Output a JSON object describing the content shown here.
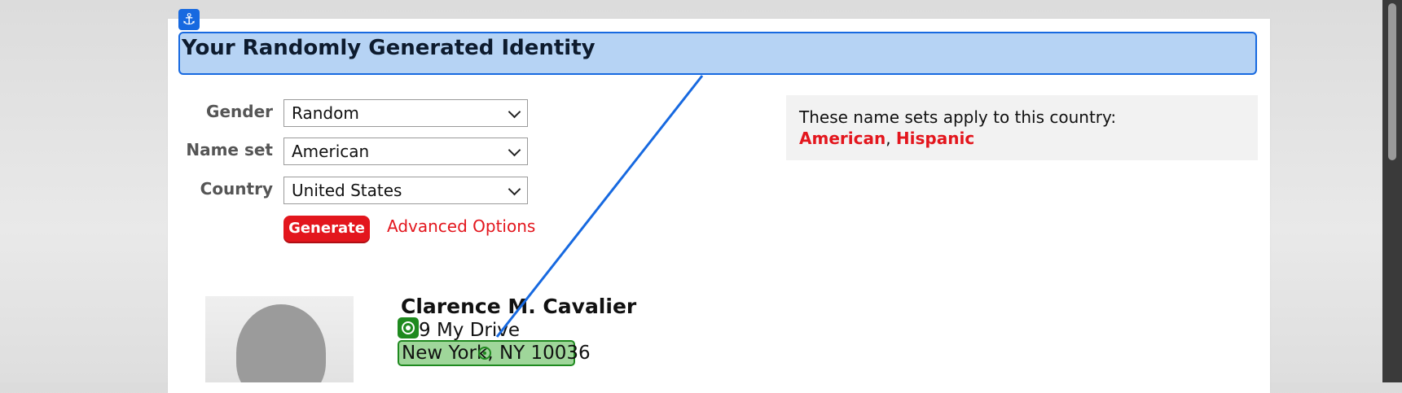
{
  "page": {
    "title": "Your Randomly Generated Identity"
  },
  "form": {
    "gender_label": "Gender",
    "gender_value": "Random",
    "nameset_label": "Name set",
    "nameset_value": "American",
    "country_label": "Country",
    "country_value": "United States",
    "generate_label": "Generate",
    "advanced_label": "Advanced Options"
  },
  "namesets": {
    "intro": "These name sets apply to this country:",
    "items": [
      "American",
      "Hispanic"
    ],
    "separator": ", "
  },
  "identity": {
    "name": "Clarence M. Cavalier",
    "street_visible": "9 My Drive",
    "city": "New York, NY 10036"
  },
  "icons": {
    "anchor": "anchor-icon",
    "target": "target-icon",
    "mask": "target-mask-icon"
  },
  "colors": {
    "accent_blue": "#1769e0",
    "title_fill": "#b6d3f4",
    "brand_red": "#e3161d",
    "highlight_green": "#1f8a1f",
    "highlight_fill": "#9fd69a"
  }
}
